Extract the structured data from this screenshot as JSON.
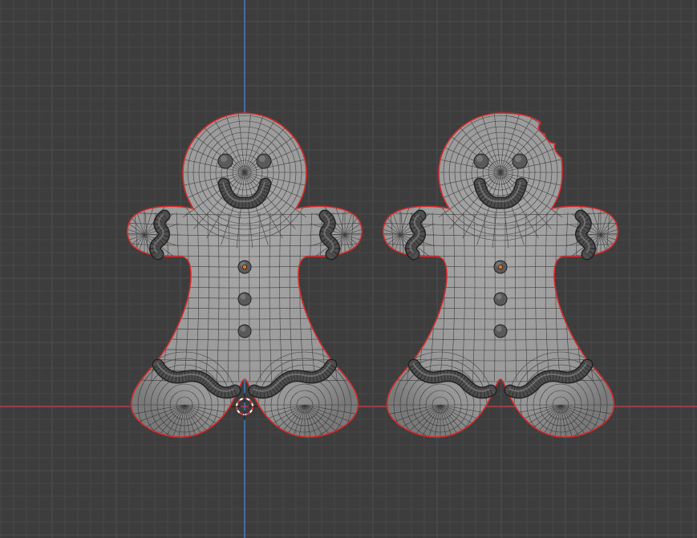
{
  "viewport": {
    "view": "front-orthographic",
    "mode": "edit-mode-wireframe",
    "grid": true
  },
  "colors": {
    "background": "#3d3d3d",
    "grid_minor": "#464646",
    "grid_major": "#4f4f4f",
    "x_axis": "#c8434b",
    "z_axis": "#4a86d8",
    "mesh_fill": "#9c9c9c",
    "mesh_wire": "#2e2e2e",
    "selection_outline": "#d62a2a",
    "icing": "#4e4e4e",
    "active_vertex": "#e8782a",
    "cursor_red": "#e03c3c",
    "cursor_white": "#ffffff"
  },
  "objects": [
    {
      "name": "gingerbread-man-left",
      "icons": "mesh",
      "bitten": false
    },
    {
      "name": "gingerbread-man-right",
      "icons": "mesh",
      "bitten": true
    }
  ],
  "icons": [
    "3d-cursor-icon",
    "origin-point-icon"
  ]
}
